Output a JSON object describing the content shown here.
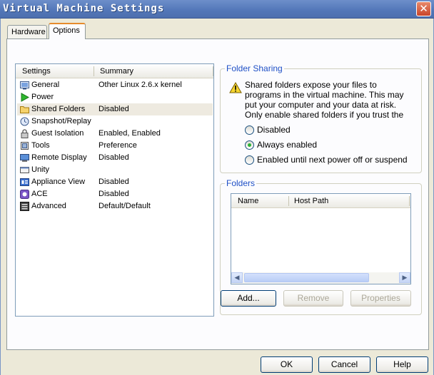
{
  "window": {
    "title": "Virtual Machine Settings",
    "close_symbol": "✕"
  },
  "tabs": [
    {
      "label": "Hardware"
    },
    {
      "label": "Options"
    }
  ],
  "settings_list": {
    "headers": {
      "settings": "Settings",
      "summary": "Summary"
    },
    "rows": [
      {
        "name": "General",
        "summary": "Other Linux 2.6.x kernel",
        "icon": "general-icon"
      },
      {
        "name": "Power",
        "summary": "",
        "icon": "power-icon"
      },
      {
        "name": "Shared Folders",
        "summary": "Disabled",
        "icon": "folder-icon"
      },
      {
        "name": "Snapshot/Replay",
        "summary": "",
        "icon": "snapshot-icon"
      },
      {
        "name": "Guest Isolation",
        "summary": "Enabled, Enabled",
        "icon": "isolation-icon"
      },
      {
        "name": "Tools",
        "summary": "Preference",
        "icon": "tools-icon"
      },
      {
        "name": "Remote Display",
        "summary": "Disabled",
        "icon": "remote-display-icon"
      },
      {
        "name": "Unity",
        "summary": "",
        "icon": "unity-icon"
      },
      {
        "name": "Appliance View",
        "summary": "Disabled",
        "icon": "appliance-icon"
      },
      {
        "name": "ACE",
        "summary": "Disabled",
        "icon": "ace-icon"
      },
      {
        "name": "Advanced",
        "summary": "Default/Default",
        "icon": "advanced-icon"
      }
    ]
  },
  "folder_sharing": {
    "label": "Folder Sharing",
    "warning_lines": [
      "Shared folders expose your files to",
      "programs in the virtual machine. This may",
      "put your computer and your data at risk.",
      "Only enable shared folders if you trust the"
    ],
    "options": [
      {
        "label": "Disabled",
        "checked": false
      },
      {
        "label": "Always enabled",
        "checked": true
      },
      {
        "label": "Enabled until next power off or suspend",
        "checked": false
      }
    ]
  },
  "folders": {
    "label": "Folders",
    "headers": {
      "name": "Name",
      "host_path": "Host Path"
    },
    "buttons": {
      "add": "Add...",
      "remove": "Remove",
      "properties": "Properties"
    }
  },
  "footer": {
    "ok": "OK",
    "cancel": "Cancel",
    "help": "Help"
  },
  "colors": {
    "accent": "#1f50c6",
    "title_bar": "#5276b8",
    "selected_row": "#eeeae0"
  }
}
